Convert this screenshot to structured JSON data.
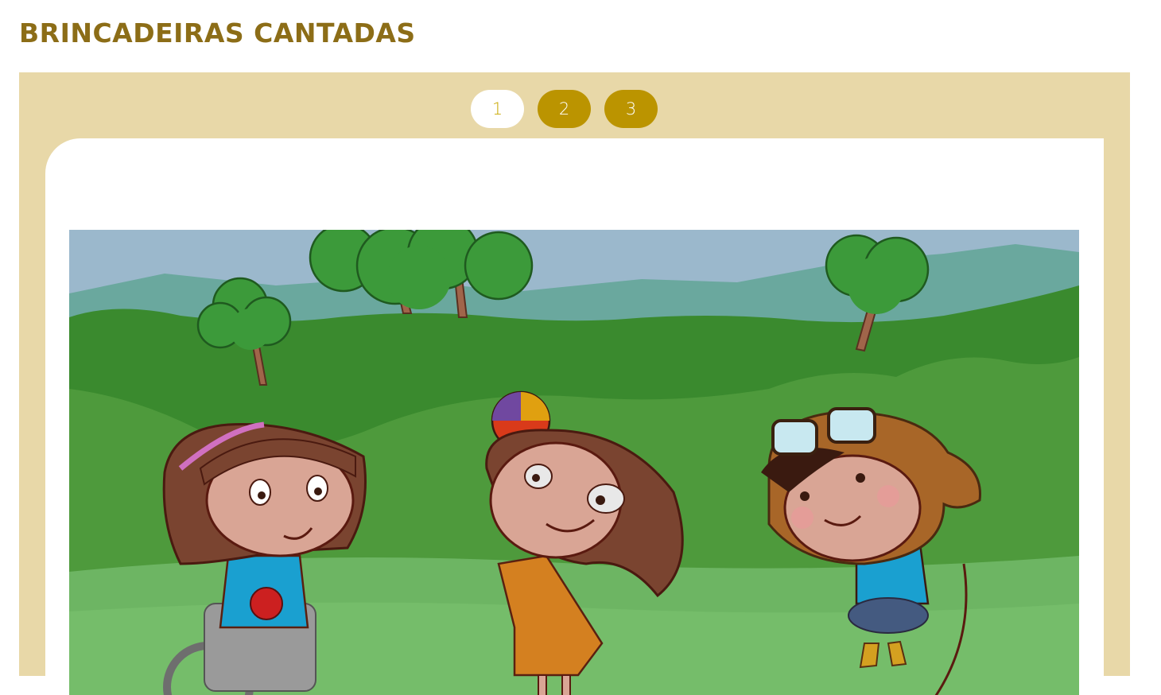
{
  "page": {
    "title": "BRINCADEIRAS CANTADAS"
  },
  "pagination": {
    "pages": [
      "1",
      "2",
      "3"
    ],
    "current": "1"
  },
  "colors": {
    "title": "#8c6d17",
    "panel_bg": "#e8d8a8",
    "active_page_bg": "#ffffff",
    "active_page_text": "#c9a800",
    "inactive_page_bg": "#bb9400",
    "inactive_page_text": "#ffffff"
  },
  "illustration": {
    "icon": "cartoon-children-playing-in-park"
  }
}
